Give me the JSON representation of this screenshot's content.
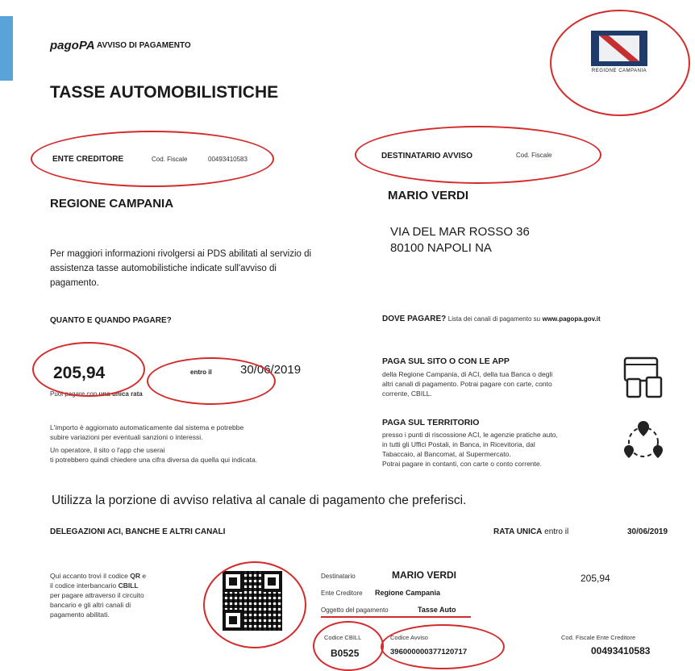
{
  "header": {
    "brand": "pagoPA",
    "notice_label": "AVVISO DI PAGAMENTO",
    "title": "TASSE AUTOMOBILISTICHE",
    "logo_caption": "REGIONE CAMPANIA"
  },
  "creditor": {
    "heading": "ENTE CREDITORE",
    "fiscal_label": "Cod. Fiscale",
    "fiscal_code": "00493410583",
    "name": "REGIONE CAMPANIA"
  },
  "recipient": {
    "heading": "DESTINATARIO AVVISO",
    "fiscal_label": "Cod. Fiscale",
    "name": "MARIO VERDI",
    "address_line1": "VIA DEL MAR ROSSO 36",
    "address_line2": "80100 NAPOLI NA"
  },
  "info": {
    "line1": "Per maggiori informazioni rivolgersi ai PDS abilitati al servizio di",
    "line2": "assistenza tasse automobilistiche indicate sull'avviso di",
    "line3": "pagamento."
  },
  "how_much": {
    "heading": "QUANTO E QUANDO PAGARE?",
    "amount": "205,94",
    "by_label": "entro il",
    "due_date": "30/06/2019",
    "single_pay_prefix": "Puoi pagare con",
    "single_pay_bold": "una unica rata",
    "note1": "L'importo è aggiornato automaticamente dal sistema e potrebbe",
    "note2": "subire variazioni per eventuali sanzioni o interessi.",
    "note3": "Un operatore, il sito o l'app che userai",
    "note4": "ti potrebbero quindi chiedere una cifra diversa da quella qui indicata."
  },
  "where": {
    "heading": "DOVE PAGARE?",
    "list_prefix": "Lista dei canali di pagamento su",
    "list_site": "www.pagopa.gov.it",
    "online_title": "PAGA SUL SITO O CON LE APP",
    "online_l1": "della Regione Campania, di ACI, della tua Banca o degli",
    "online_l2": "altri canali di pagamento. Potrai pagare con carte, conto",
    "online_l3": "corrente, CBILL.",
    "local_title": "PAGA SUL TERRITORIO",
    "local_l1": "presso i punti di riscossione ACI, le agenzie pratiche auto,",
    "local_l2": "in tutti gli Uffici Postali, in Banca, in Ricevitoria, dal",
    "local_l3": "Tabaccaio, al Bancomat, al Supermercato.",
    "local_l4": "Potrai pagare in contanti, con carte o conto corrente.",
    "online_icon": "devices-icon",
    "local_icon": "map-pins-icon"
  },
  "instruction": "Utilizza la porzione di avviso relativa al canale di pagamento che preferisci.",
  "slip": {
    "heading": "DELEGAZIONI ACI, BANCHE E ALTRI CANALI",
    "rate_label": "RATA UNICA",
    "rate_by": "entro il",
    "rate_date": "30/06/2019",
    "qr_l1_a": "Qui accanto trovi il codice ",
    "qr_l1_b": "QR",
    "qr_l1_c": " e",
    "qr_l2_a": "il codice interbancario ",
    "qr_l2_b": "CBILL",
    "qr_l3": "per pagare attraverso il circuito",
    "qr_l4": "bancario e gli altri canali di",
    "qr_l5": "pagamento abilitati.",
    "recipient_label": "Destinatario",
    "recipient_value": "MARIO VERDI",
    "creditor_label": "Ente Creditore",
    "creditor_value": "Regione Campania",
    "object_label": "Oggetto del pagamento",
    "object_value": "Tasse Auto",
    "amount": "205,94",
    "cbill_label": "Codice CBILL",
    "cbill_value": "B0525",
    "notice_code_label": "Codice Avviso",
    "notice_code_value": "396000000377120717",
    "creditor_fiscal_label": "Cod. Fiscale Ente Creditore",
    "creditor_fiscal_value": "00493410583"
  },
  "colors": {
    "annotation": "#d42a2a",
    "logo_blue": "#1f3b6b"
  }
}
